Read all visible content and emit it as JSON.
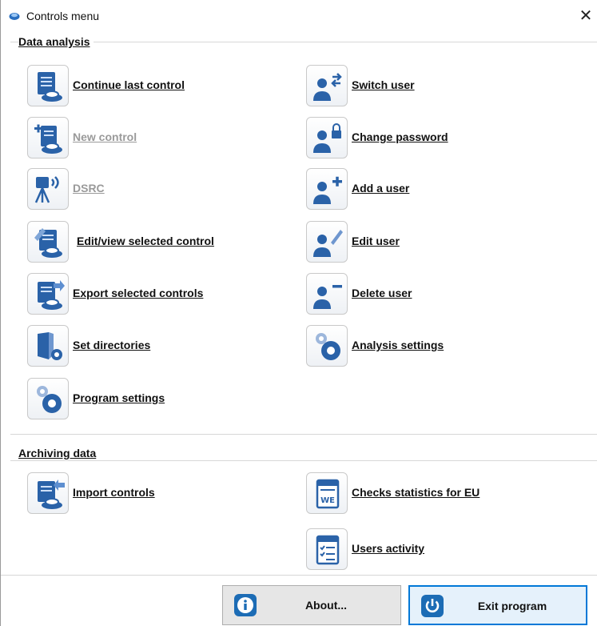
{
  "window": {
    "title": "Controls menu",
    "close_glyph": "✕"
  },
  "sections": {
    "data_analysis": "Data analysis",
    "archiving": "Archiving data"
  },
  "left_items": [
    {
      "label": "Continue last control",
      "icon": "document-user-icon",
      "enabled": true
    },
    {
      "label": "New control",
      "icon": "new-document-user-icon",
      "enabled": false
    },
    {
      "label": "DSRC",
      "icon": "dsrc-antenna-icon",
      "enabled": false
    },
    {
      "label": "Edit/view selected control",
      "icon": "edit-document-icon",
      "enabled": true
    },
    {
      "label": "Export selected controls",
      "icon": "export-document-icon",
      "enabled": true
    },
    {
      "label": "Set directories",
      "icon": "folder-gear-icon",
      "enabled": true
    },
    {
      "label": "Program settings",
      "icon": "gears-icon",
      "enabled": true
    }
  ],
  "right_items": [
    {
      "label": "Switch user",
      "icon": "switch-user-icon",
      "enabled": true
    },
    {
      "label": "Change password",
      "icon": "user-lock-icon",
      "enabled": true
    },
    {
      "label": "Add a user",
      "icon": "add-user-icon",
      "enabled": true
    },
    {
      "label": "Edit user",
      "icon": "edit-user-icon",
      "enabled": true
    },
    {
      "label": "Delete user",
      "icon": "delete-user-icon",
      "enabled": true
    },
    {
      "label": "Analysis settings",
      "icon": "gears-icon",
      "enabled": true
    }
  ],
  "archive_items": {
    "import": {
      "label": "Import controls",
      "icon": "import-document-icon"
    },
    "eu_stats": {
      "label": "Checks statistics for EU",
      "icon": "we-document-icon",
      "icon_text": "WE"
    },
    "users_activity": {
      "label": "Users activity",
      "icon": "checklist-document-icon"
    }
  },
  "buttons": {
    "about": "About...",
    "exit": "Exit program"
  },
  "colors": {
    "accent": "#0078d7",
    "icon_blue": "#2a62a8",
    "disabled_text": "#9a9a9a"
  }
}
